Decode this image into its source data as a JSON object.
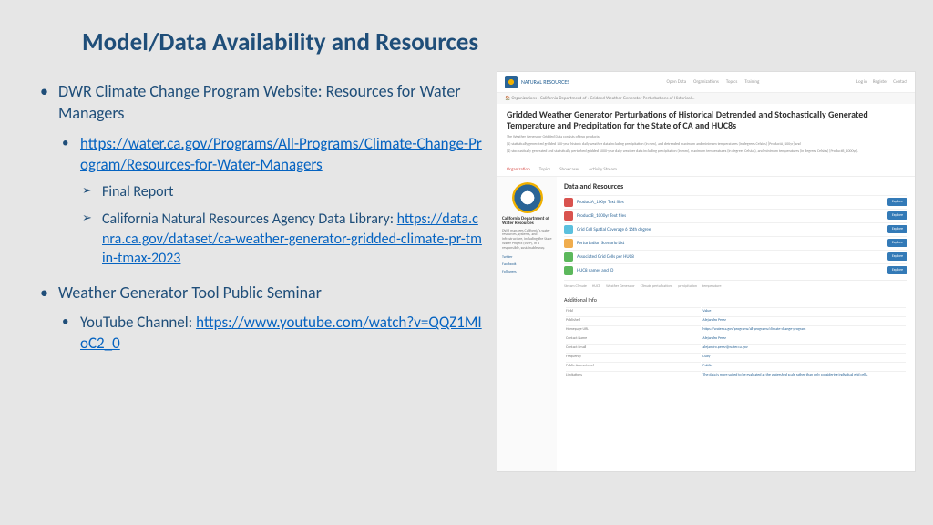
{
  "title": "Model/Data Availability and Resources",
  "bullets": {
    "b1": "DWR Climate Change Program Website: Resources for Water Managers",
    "b1a": "https://water.ca.gov/Programs/All-Programs/Climate-Change-Program/Resources-for-Water-Managers",
    "b1a_i": "Final Report",
    "b1a_ii_pre": "California Natural Resources Agency Data Library: ",
    "b1a_ii_link": "https://data.cnra.ca.gov/dataset/ca-weather-generator-gridded-climate-pr-tmin-tmax-2023",
    "b2": "Weather Generator Tool Public Seminar",
    "b2a_pre": "YouTube Channel: ",
    "b2a_link": "https://www.youtube.com/watch?v=QQZ1MIoC2_0"
  },
  "shot": {
    "logo": "NATURAL RESOURCES",
    "nav": [
      "Open Data",
      "Organizations",
      "Topics",
      "Training"
    ],
    "toplinks": [
      "Log in",
      "Register",
      "Contact"
    ],
    "crumb_home": "Organizations",
    "crumb_a": "California Department of",
    "crumb_b": "Gridded Weather Generator Perturbations of Historical...",
    "page_title": "Gridded Weather Generator Perturbations of Historical Detrended and Stochastically Generated Temperature and Precipitation for the State of CA and HUC8s",
    "para1": "The Weather Generator Gridded Data consists of two products:",
    "para2": "(1) statistically generated gridded 100-year historic daily weather data including precipitation (in mm), and detrended maximum and minimum temperatures (in degrees Celsius) [ProductA_100yr] and",
    "para3": "(2) stochastically generated and statistically perturbed gridded 1000-year daily weather data including precipitation (in mm), maximum temperatures (in degrees Celsius), and minimum temperatures (in degrees Celsius) [ProductB_1000yr].",
    "tabs": {
      "a": "Organization",
      "b": "Topics",
      "c": "Showcases",
      "d": "Activity Stream"
    },
    "side_title": "California Department of Water Resources",
    "side_desc": "DWR manages California's water resources, systems, and infrastructure, including the State Water Project (SWP), in a responsible, sustainable way.",
    "side_links": [
      "Twitter",
      "Facebook",
      "Followers"
    ],
    "dr_title": "Data and Resources",
    "resources": [
      {
        "color": "red",
        "label": "ProductA_100yr Text files"
      },
      {
        "color": "red",
        "label": "ProductB_1000yr Text files"
      },
      {
        "color": "blue",
        "label": "Grid Cell Spatial Coverage 6 16th degree"
      },
      {
        "color": "yellow",
        "label": "Perturbation Scenario List"
      },
      {
        "color": "green",
        "label": "Associated Grid Cells per HUC8"
      },
      {
        "color": "green",
        "label": "HUC8 names and ID"
      }
    ],
    "explore": "Explore",
    "tags": [
      "Stream Climate",
      "HUC8",
      "Weather Generator",
      "Climate perturbations",
      "precipitation",
      "temperature"
    ],
    "ai_title": "Additional Info",
    "ai": [
      {
        "k": "Field",
        "v": "Value"
      },
      {
        "k": "Published",
        "v": "Alejandro Perez"
      },
      {
        "k": "Homepage URL",
        "v": "https://water.ca.gov/programs/all-programs/climate-change-program"
      },
      {
        "k": "Contact Name",
        "v": "Alejandro Perez"
      },
      {
        "k": "Contact Email",
        "v": "alejandro.perez@water.ca.gov"
      },
      {
        "k": "Frequency",
        "v": "Daily"
      },
      {
        "k": "Public Access Level",
        "v": "Public"
      },
      {
        "k": "Limitations",
        "v": "The data is more suited to be evaluated at the watershed scale rather than only considering individual grid cells."
      }
    ]
  }
}
